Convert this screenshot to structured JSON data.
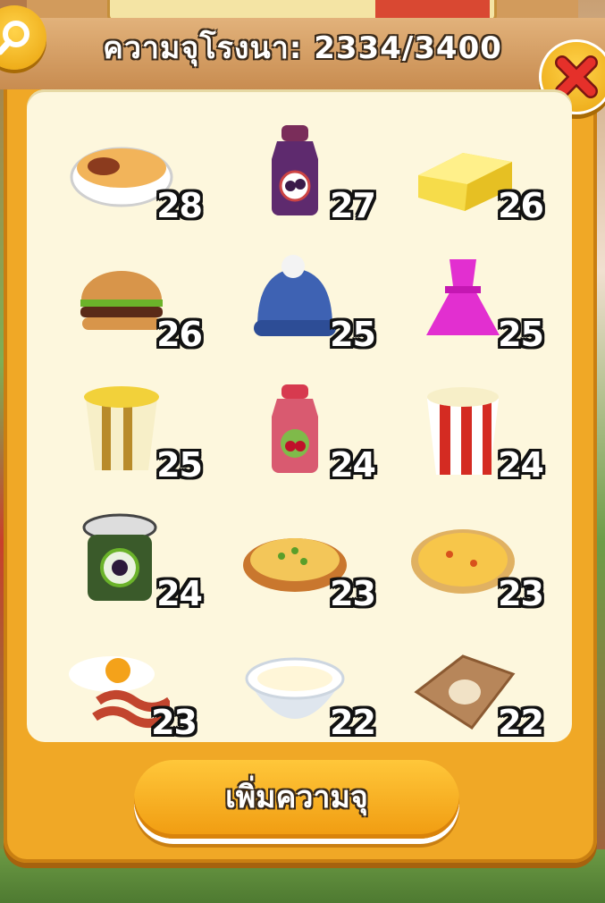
{
  "header": {
    "title": "ความจุโรงนา: 2334/3400"
  },
  "items": [
    {
      "name": "shepherds-pie",
      "count": "28"
    },
    {
      "name": "blackberry-juice",
      "count": "27"
    },
    {
      "name": "butter",
      "count": "26"
    },
    {
      "name": "hamburger",
      "count": "26"
    },
    {
      "name": "wool-hat",
      "count": "25"
    },
    {
      "name": "pink-dress",
      "count": "25"
    },
    {
      "name": "buttered-popcorn",
      "count": "25"
    },
    {
      "name": "cherry-juice",
      "count": "24"
    },
    {
      "name": "popcorn",
      "count": "24"
    },
    {
      "name": "blackberry-jam",
      "count": "24"
    },
    {
      "name": "quiche",
      "count": "23"
    },
    {
      "name": "pizza",
      "count": "23"
    },
    {
      "name": "bacon-and-eggs",
      "count": "23"
    },
    {
      "name": "cream",
      "count": "22"
    },
    {
      "name": "goat-cheese-sack",
      "count": "22"
    }
  ],
  "footer": {
    "action_label": "เพิ่มความจุ"
  },
  "colors": {
    "panel": "#f0a826",
    "inner": "#fdf7dd",
    "close_red": "#e5302a"
  }
}
